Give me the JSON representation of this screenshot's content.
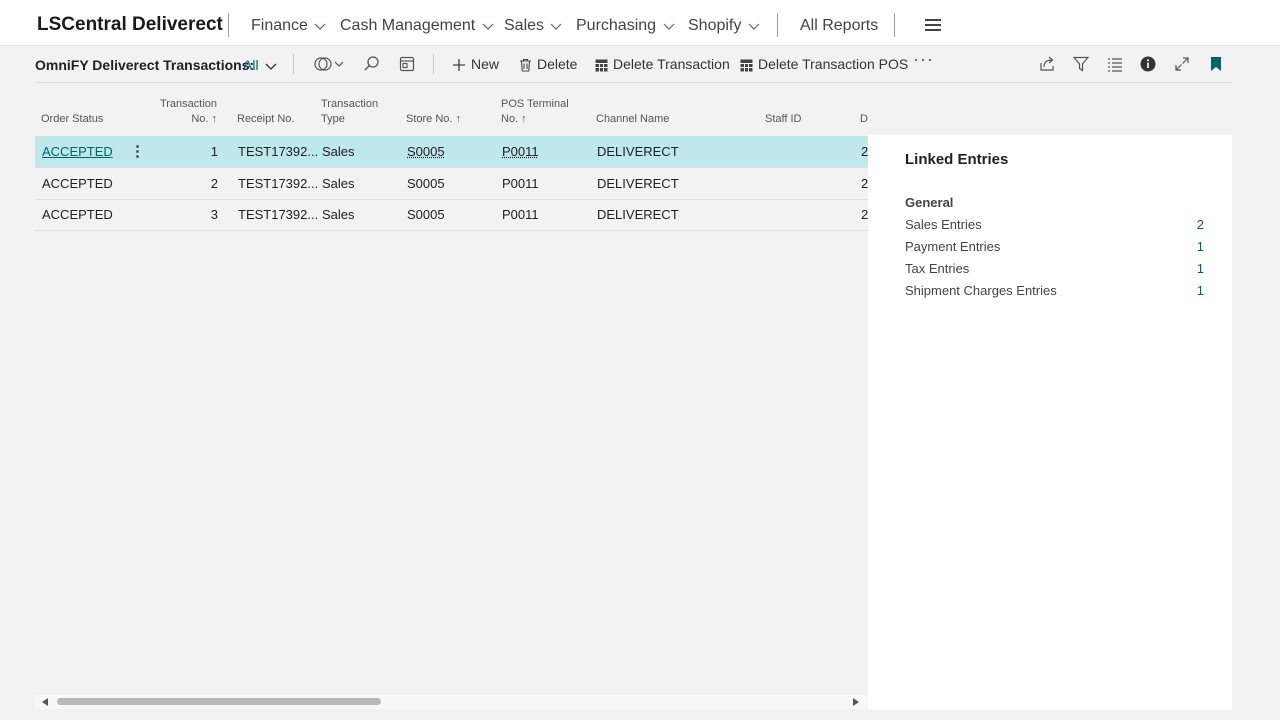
{
  "app_title": "LSCentral Deliverect",
  "nav": {
    "items": [
      {
        "label": "Finance",
        "has_menu": true
      },
      {
        "label": "Cash Management",
        "has_menu": true
      },
      {
        "label": "Sales",
        "has_menu": true
      },
      {
        "label": "Purchasing",
        "has_menu": true
      },
      {
        "label": "Shopify",
        "has_menu": true
      }
    ],
    "all_reports": "All Reports"
  },
  "actionbar": {
    "title": "OmniFY Deliverect Transactions:",
    "filter_label": "All",
    "new_label": "New",
    "delete_label": "Delete",
    "delete_transaction_label": "Delete Transaction",
    "delete_transaction_pos_label": "Delete Transaction POS",
    "more_label": "···"
  },
  "table": {
    "headers": {
      "order_status": "Order Status",
      "transaction_no_1": "Transaction",
      "transaction_no_2": "No. ↑",
      "receipt_no": "Receipt No.",
      "transaction_type_1": "Transaction",
      "transaction_type_2": "Type",
      "store_no": "Store No. ↑",
      "pos_terminal_1": "POS Terminal",
      "pos_terminal_2": "No. ↑",
      "channel_name": "Channel Name",
      "staff_id": "Staff ID",
      "d": "D"
    },
    "rows": [
      {
        "order_status": "ACCEPTED",
        "transaction_no": "1",
        "receipt_no": "TEST17392...",
        "transaction_type": "Sales",
        "store_no": "S0005",
        "pos_terminal_no": "P0011",
        "channel_name": "DELIVERECT",
        "staff_id": "",
        "d": "2"
      },
      {
        "order_status": "ACCEPTED",
        "transaction_no": "2",
        "receipt_no": "TEST17392...",
        "transaction_type": "Sales",
        "store_no": "S0005",
        "pos_terminal_no": "P0011",
        "channel_name": "DELIVERECT",
        "staff_id": "",
        "d": "2"
      },
      {
        "order_status": "ACCEPTED",
        "transaction_no": "3",
        "receipt_no": "TEST17392...",
        "transaction_type": "Sales",
        "store_no": "S0005",
        "pos_terminal_no": "P0011",
        "channel_name": "DELIVERECT",
        "staff_id": "",
        "d": "2"
      }
    ],
    "selected_row": 0,
    "row_menu": "⋮"
  },
  "factbox": {
    "title": "Linked Entries",
    "group": "General",
    "entries": [
      {
        "label": "Sales Entries",
        "value": "2"
      },
      {
        "label": "Payment Entries",
        "value": "1"
      },
      {
        "label": "Tax Entries",
        "value": "1"
      },
      {
        "label": "Shipment Charges Entries",
        "value": "1"
      }
    ]
  },
  "colors": {
    "accent": "#00646e",
    "selected_row": "#bfe8ec",
    "background": "#f2f2f2"
  }
}
